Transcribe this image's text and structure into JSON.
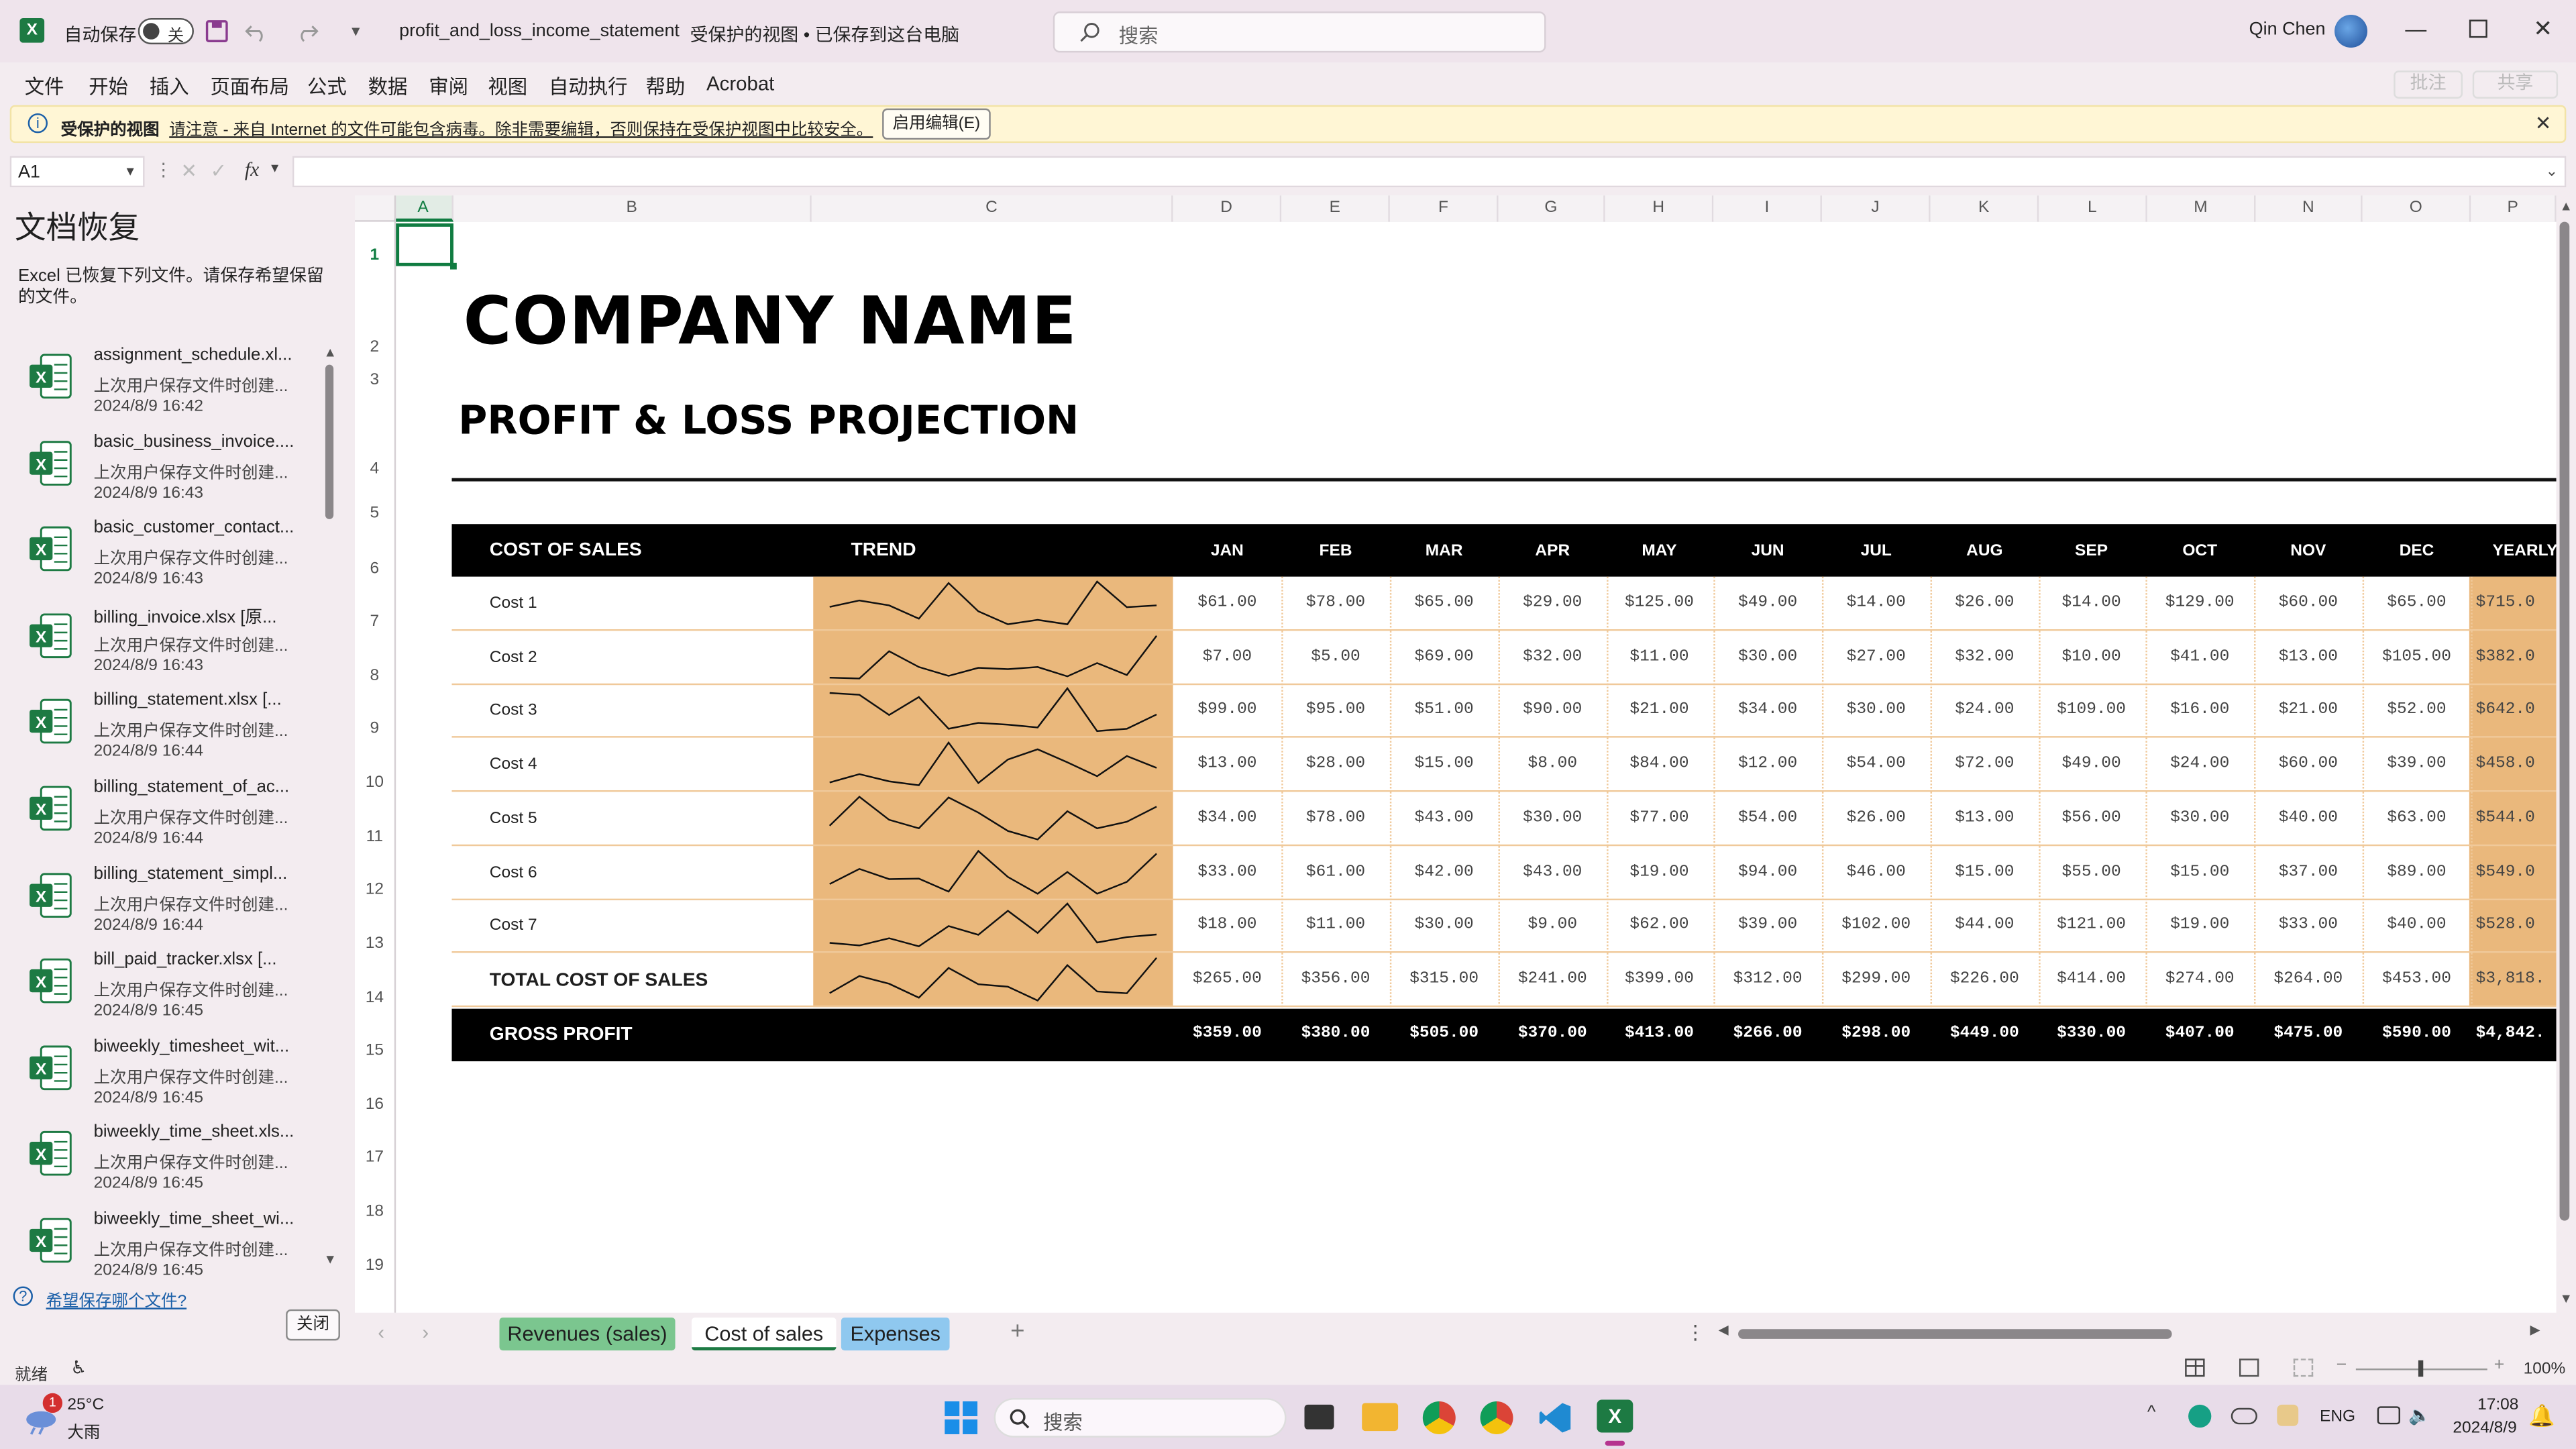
{
  "window": {
    "autosave_label": "自动保存",
    "autosave_state": "关",
    "filename": "profit_and_loss_income_statement",
    "status": "受保护的视图 • 已保存到这台电脑",
    "search_placeholder": "搜索",
    "user_name": "Qin Chen"
  },
  "menu": {
    "items": [
      "文件",
      "开始",
      "插入",
      "页面布局",
      "公式",
      "数据",
      "审阅",
      "视图",
      "自动执行",
      "帮助",
      "Acrobat"
    ],
    "comments": "批注",
    "share": "共享"
  },
  "protected_view": {
    "title": "受保护的视图",
    "message": "请注意 - 来自 Internet 的文件可能包含病毒。除非需要编辑，否则保持在受保护视图中比较安全。",
    "enable_button": "启用编辑(E)"
  },
  "formula_bar": {
    "name_box": "A1",
    "fx": "fx",
    "formula": ""
  },
  "recovery": {
    "title": "文档恢复",
    "description": "Excel 已恢复下列文件。请保存希望保留的文件。",
    "files": [
      {
        "name": "assignment_schedule.xl...",
        "sub": "上次用户保存文件时创建...",
        "date": "2024/8/9 16:42"
      },
      {
        "name": "basic_business_invoice....",
        "sub": "上次用户保存文件时创建...",
        "date": "2024/8/9 16:43"
      },
      {
        "name": "basic_customer_contact...",
        "sub": "上次用户保存文件时创建...",
        "date": "2024/8/9 16:43"
      },
      {
        "name": "billing_invoice.xlsx  [原...",
        "sub": "上次用户保存文件时创建...",
        "date": "2024/8/9 16:43"
      },
      {
        "name": "billing_statement.xlsx  [...",
        "sub": "上次用户保存文件时创建...",
        "date": "2024/8/9 16:44"
      },
      {
        "name": "billing_statement_of_ac...",
        "sub": "上次用户保存文件时创建...",
        "date": "2024/8/9 16:44"
      },
      {
        "name": "billing_statement_simpl...",
        "sub": "上次用户保存文件时创建...",
        "date": "2024/8/9 16:44"
      },
      {
        "name": "bill_paid_tracker.xlsx  [...",
        "sub": "上次用户保存文件时创建...",
        "date": "2024/8/9 16:45"
      },
      {
        "name": "biweekly_timesheet_wit...",
        "sub": "上次用户保存文件时创建...",
        "date": "2024/8/9 16:45"
      },
      {
        "name": "biweekly_time_sheet.xls...",
        "sub": "上次用户保存文件时创建...",
        "date": "2024/8/9 16:45"
      },
      {
        "name": "biweekly_time_sheet_wi...",
        "sub": "上次用户保存文件时创建...",
        "date": "2024/8/9 16:45"
      }
    ],
    "help_link": "希望保存哪个文件?",
    "close_button": "关闭"
  },
  "grid": {
    "columns": [
      "A",
      "B",
      "C",
      "D",
      "E",
      "F",
      "G",
      "H",
      "I",
      "J",
      "K",
      "L",
      "M",
      "N",
      "O",
      "P"
    ],
    "rows": [
      "1",
      "2",
      "3",
      "4",
      "5",
      "6",
      "7",
      "8",
      "9",
      "10",
      "11",
      "12",
      "13",
      "14",
      "15",
      "16",
      "17",
      "18",
      "19"
    ]
  },
  "sheet": {
    "company": "COMPANY NAME",
    "subtitle": "PROFIT & LOSS PROJECTION",
    "header_label": "COST OF SALES",
    "trend_label": "TREND",
    "months": [
      "JAN",
      "FEB",
      "MAR",
      "APR",
      "MAY",
      "JUN",
      "JUL",
      "AUG",
      "SEP",
      "OCT",
      "NOV",
      "DEC",
      "YEARLY"
    ],
    "cost_rows": [
      {
        "label": "Cost 1",
        "values": [
          "$61.00",
          "$78.00",
          "$65.00",
          "$29.00",
          "$125.00",
          "$49.00",
          "$14.00",
          "$26.00",
          "$14.00",
          "$129.00",
          "$60.00",
          "$65.00"
        ],
        "yearly": "$715.0",
        "spark": [
          61,
          78,
          65,
          29,
          125,
          49,
          14,
          26,
          14,
          129,
          60,
          65
        ]
      },
      {
        "label": "Cost 2",
        "values": [
          "$7.00",
          "$5.00",
          "$69.00",
          "$32.00",
          "$11.00",
          "$30.00",
          "$27.00",
          "$32.00",
          "$10.00",
          "$41.00",
          "$13.00",
          "$105.00"
        ],
        "yearly": "$382.0",
        "spark": [
          7,
          5,
          69,
          32,
          11,
          30,
          27,
          32,
          10,
          41,
          13,
          105
        ]
      },
      {
        "label": "Cost 3",
        "values": [
          "$99.00",
          "$95.00",
          "$51.00",
          "$90.00",
          "$21.00",
          "$34.00",
          "$30.00",
          "$24.00",
          "$109.00",
          "$16.00",
          "$21.00",
          "$52.00"
        ],
        "yearly": "$642.0",
        "spark": [
          99,
          95,
          51,
          90,
          21,
          34,
          30,
          24,
          109,
          16,
          21,
          52
        ]
      },
      {
        "label": "Cost 4",
        "values": [
          "$13.00",
          "$28.00",
          "$15.00",
          "$8.00",
          "$84.00",
          "$12.00",
          "$54.00",
          "$72.00",
          "$49.00",
          "$24.00",
          "$60.00",
          "$39.00"
        ],
        "yearly": "$458.0",
        "spark": [
          13,
          28,
          15,
          8,
          84,
          12,
          54,
          72,
          49,
          24,
          60,
          39
        ]
      },
      {
        "label": "Cost 5",
        "values": [
          "$34.00",
          "$78.00",
          "$43.00",
          "$30.00",
          "$77.00",
          "$54.00",
          "$26.00",
          "$13.00",
          "$56.00",
          "$30.00",
          "$40.00",
          "$63.00"
        ],
        "yearly": "$544.0",
        "spark": [
          34,
          78,
          43,
          30,
          77,
          54,
          26,
          13,
          56,
          30,
          40,
          63
        ]
      },
      {
        "label": "Cost 6",
        "values": [
          "$33.00",
          "$61.00",
          "$42.00",
          "$43.00",
          "$19.00",
          "$94.00",
          "$46.00",
          "$15.00",
          "$55.00",
          "$15.00",
          "$37.00",
          "$89.00"
        ],
        "yearly": "$549.0",
        "spark": [
          33,
          61,
          42,
          43,
          19,
          94,
          46,
          15,
          55,
          15,
          37,
          89
        ]
      },
      {
        "label": "Cost 7",
        "values": [
          "$18.00",
          "$11.00",
          "$30.00",
          "$9.00",
          "$62.00",
          "$39.00",
          "$102.00",
          "$44.00",
          "$121.00",
          "$19.00",
          "$33.00",
          "$40.00"
        ],
        "yearly": "$528.0",
        "spark": [
          18,
          11,
          30,
          9,
          62,
          39,
          102,
          44,
          121,
          19,
          33,
          40
        ]
      }
    ],
    "total": {
      "label": "TOTAL COST OF SALES",
      "values": [
        "$265.00",
        "$356.00",
        "$315.00",
        "$241.00",
        "$399.00",
        "$312.00",
        "$299.00",
        "$226.00",
        "$414.00",
        "$274.00",
        "$264.00",
        "$453.00"
      ],
      "yearly": "$3,818.",
      "spark": [
        265,
        356,
        315,
        241,
        399,
        312,
        299,
        226,
        414,
        274,
        264,
        453
      ]
    },
    "gross": {
      "label": "GROSS PROFIT",
      "values": [
        "$359.00",
        "$380.00",
        "$505.00",
        "$370.00",
        "$413.00",
        "$266.00",
        "$298.00",
        "$449.00",
        "$330.00",
        "$407.00",
        "$475.00",
        "$590.00"
      ],
      "yearly": "$4,842."
    }
  },
  "tabs": [
    {
      "label": "Revenues (sales)",
      "color": "#7bc68f"
    },
    {
      "label": "Cost of sales",
      "color": "#ffffff"
    },
    {
      "label": "Expenses",
      "color": "#8fc8ef"
    }
  ],
  "status": {
    "ready": "就绪",
    "zoom": "100%"
  },
  "taskbar": {
    "temp": "25°C",
    "weather": "大雨",
    "search": "搜索",
    "lang": "ENG",
    "time": "17:08",
    "date": "2024/8/9",
    "weather_badge": "1"
  },
  "colors": {
    "accent_orange": "#eab87c",
    "header_black": "#000000",
    "excel_green": "#1d7a43"
  }
}
